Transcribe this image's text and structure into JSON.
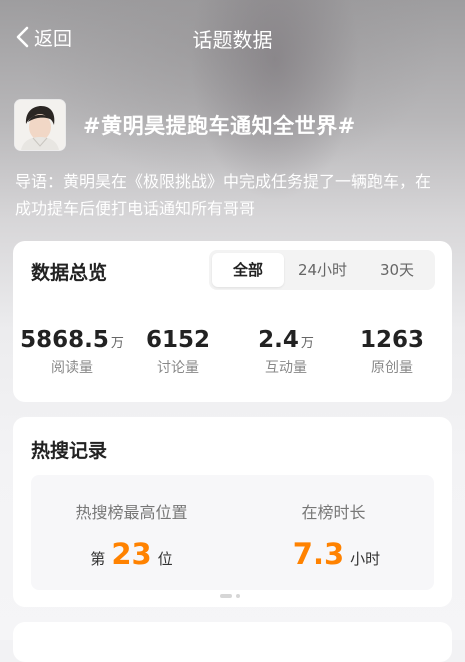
{
  "nav": {
    "back_label": "返回",
    "title": "话题数据"
  },
  "topic": {
    "title": "#黄明昊提跑车通知全世界#",
    "intro": "导语：黄明昊在《极限挑战》中完成任务提了一辆跑车，在成功提车后便打电话通知所有哥哥"
  },
  "overview": {
    "title": "数据总览",
    "tabs": [
      "全部",
      "24小时",
      "30天"
    ],
    "active_tab": "全部",
    "stats": [
      {
        "value": "5868.5",
        "unit": "万",
        "label": "阅读量"
      },
      {
        "value": "6152",
        "unit": "",
        "label": "讨论量"
      },
      {
        "value": "2.4",
        "unit": "万",
        "label": "互动量"
      },
      {
        "value": "1263",
        "unit": "",
        "label": "原创量"
      }
    ]
  },
  "hot_search": {
    "title": "热搜记录",
    "peak": {
      "label": "热搜榜最高位置",
      "prefix": "第",
      "value": "23",
      "suffix": "位"
    },
    "duration": {
      "label": "在榜时长",
      "value": "7.3",
      "suffix": "小时"
    },
    "pages": 2,
    "current_page": 1
  },
  "colors": {
    "accent": "#ff8200",
    "text": "#222222",
    "muted": "#888888"
  },
  "icons": {
    "back": "chevron-left-icon",
    "avatar": "avatar"
  }
}
